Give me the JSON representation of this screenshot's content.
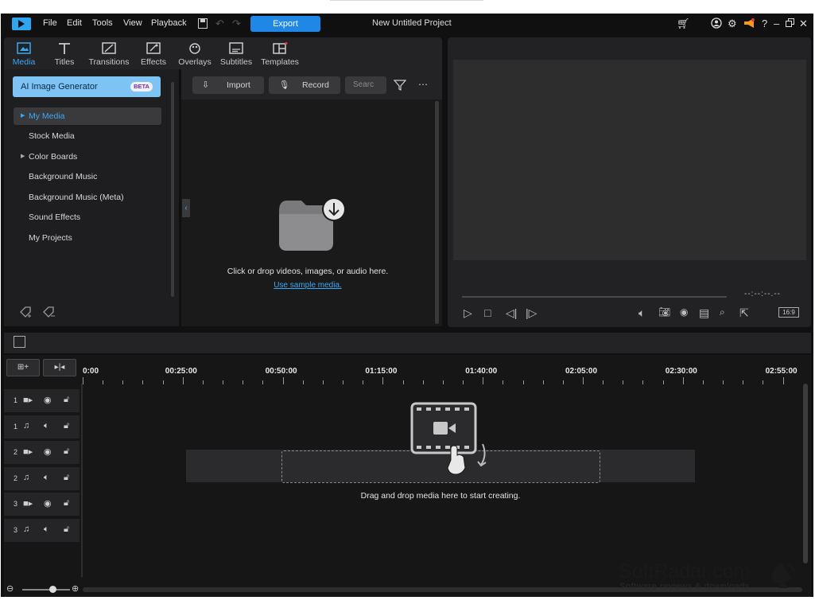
{
  "menubar": {
    "items": [
      "File",
      "Edit",
      "Tools",
      "View",
      "Playback"
    ],
    "export_label": "Export",
    "project_title": "New Untitled Project"
  },
  "tabs": [
    {
      "label": "Media",
      "icon": "media-icon",
      "active": true
    },
    {
      "label": "Titles",
      "icon": "titles-icon"
    },
    {
      "label": "Transitions",
      "icon": "transitions-icon"
    },
    {
      "label": "Effects",
      "icon": "effects-icon"
    },
    {
      "label": "Overlays",
      "icon": "overlays-icon"
    },
    {
      "label": "Subtitles",
      "icon": "subtitles-icon"
    },
    {
      "label": "Templates",
      "icon": "templates-icon"
    }
  ],
  "sidebar": {
    "ai_button": "AI Image Generator",
    "beta": "BETA",
    "items": [
      {
        "label": "My Media",
        "arrow": true,
        "selected": true
      },
      {
        "label": "Stock Media"
      },
      {
        "label": "Color Boards",
        "arrow": true
      },
      {
        "label": "Background Music"
      },
      {
        "label": "Background Music (Meta)"
      },
      {
        "label": "Sound Effects"
      },
      {
        "label": "My Projects"
      }
    ]
  },
  "library": {
    "import_label": "Import",
    "record_label": "Record",
    "search_placeholder": "Searc",
    "empty_text": "Click or drop videos, images, or audio here.",
    "sample_link": "Use sample media."
  },
  "preview": {
    "timecode": "--:--:--.--",
    "ratio": "16:9"
  },
  "timeline": {
    "ruler": [
      "0:00",
      "00:25:00",
      "00:50:00",
      "01:15:00",
      "01:40:00",
      "02:05:00",
      "02:30:00",
      "02:55:00"
    ],
    "tracks": [
      {
        "num": "1",
        "type": "video"
      },
      {
        "num": "1",
        "type": "audio"
      },
      {
        "num": "2",
        "type": "video"
      },
      {
        "num": "2",
        "type": "audio"
      },
      {
        "num": "3",
        "type": "video"
      },
      {
        "num": "3",
        "type": "audio"
      }
    ],
    "drop_text": "Drag and drop media here to start creating."
  },
  "watermark": {
    "title": "SoftRadar.com",
    "subtitle": "Software reviews & downloads"
  },
  "colors": {
    "accent": "#1f87e6",
    "active_tab": "#3aa8f5",
    "ai_button": "#7dc4f5"
  }
}
